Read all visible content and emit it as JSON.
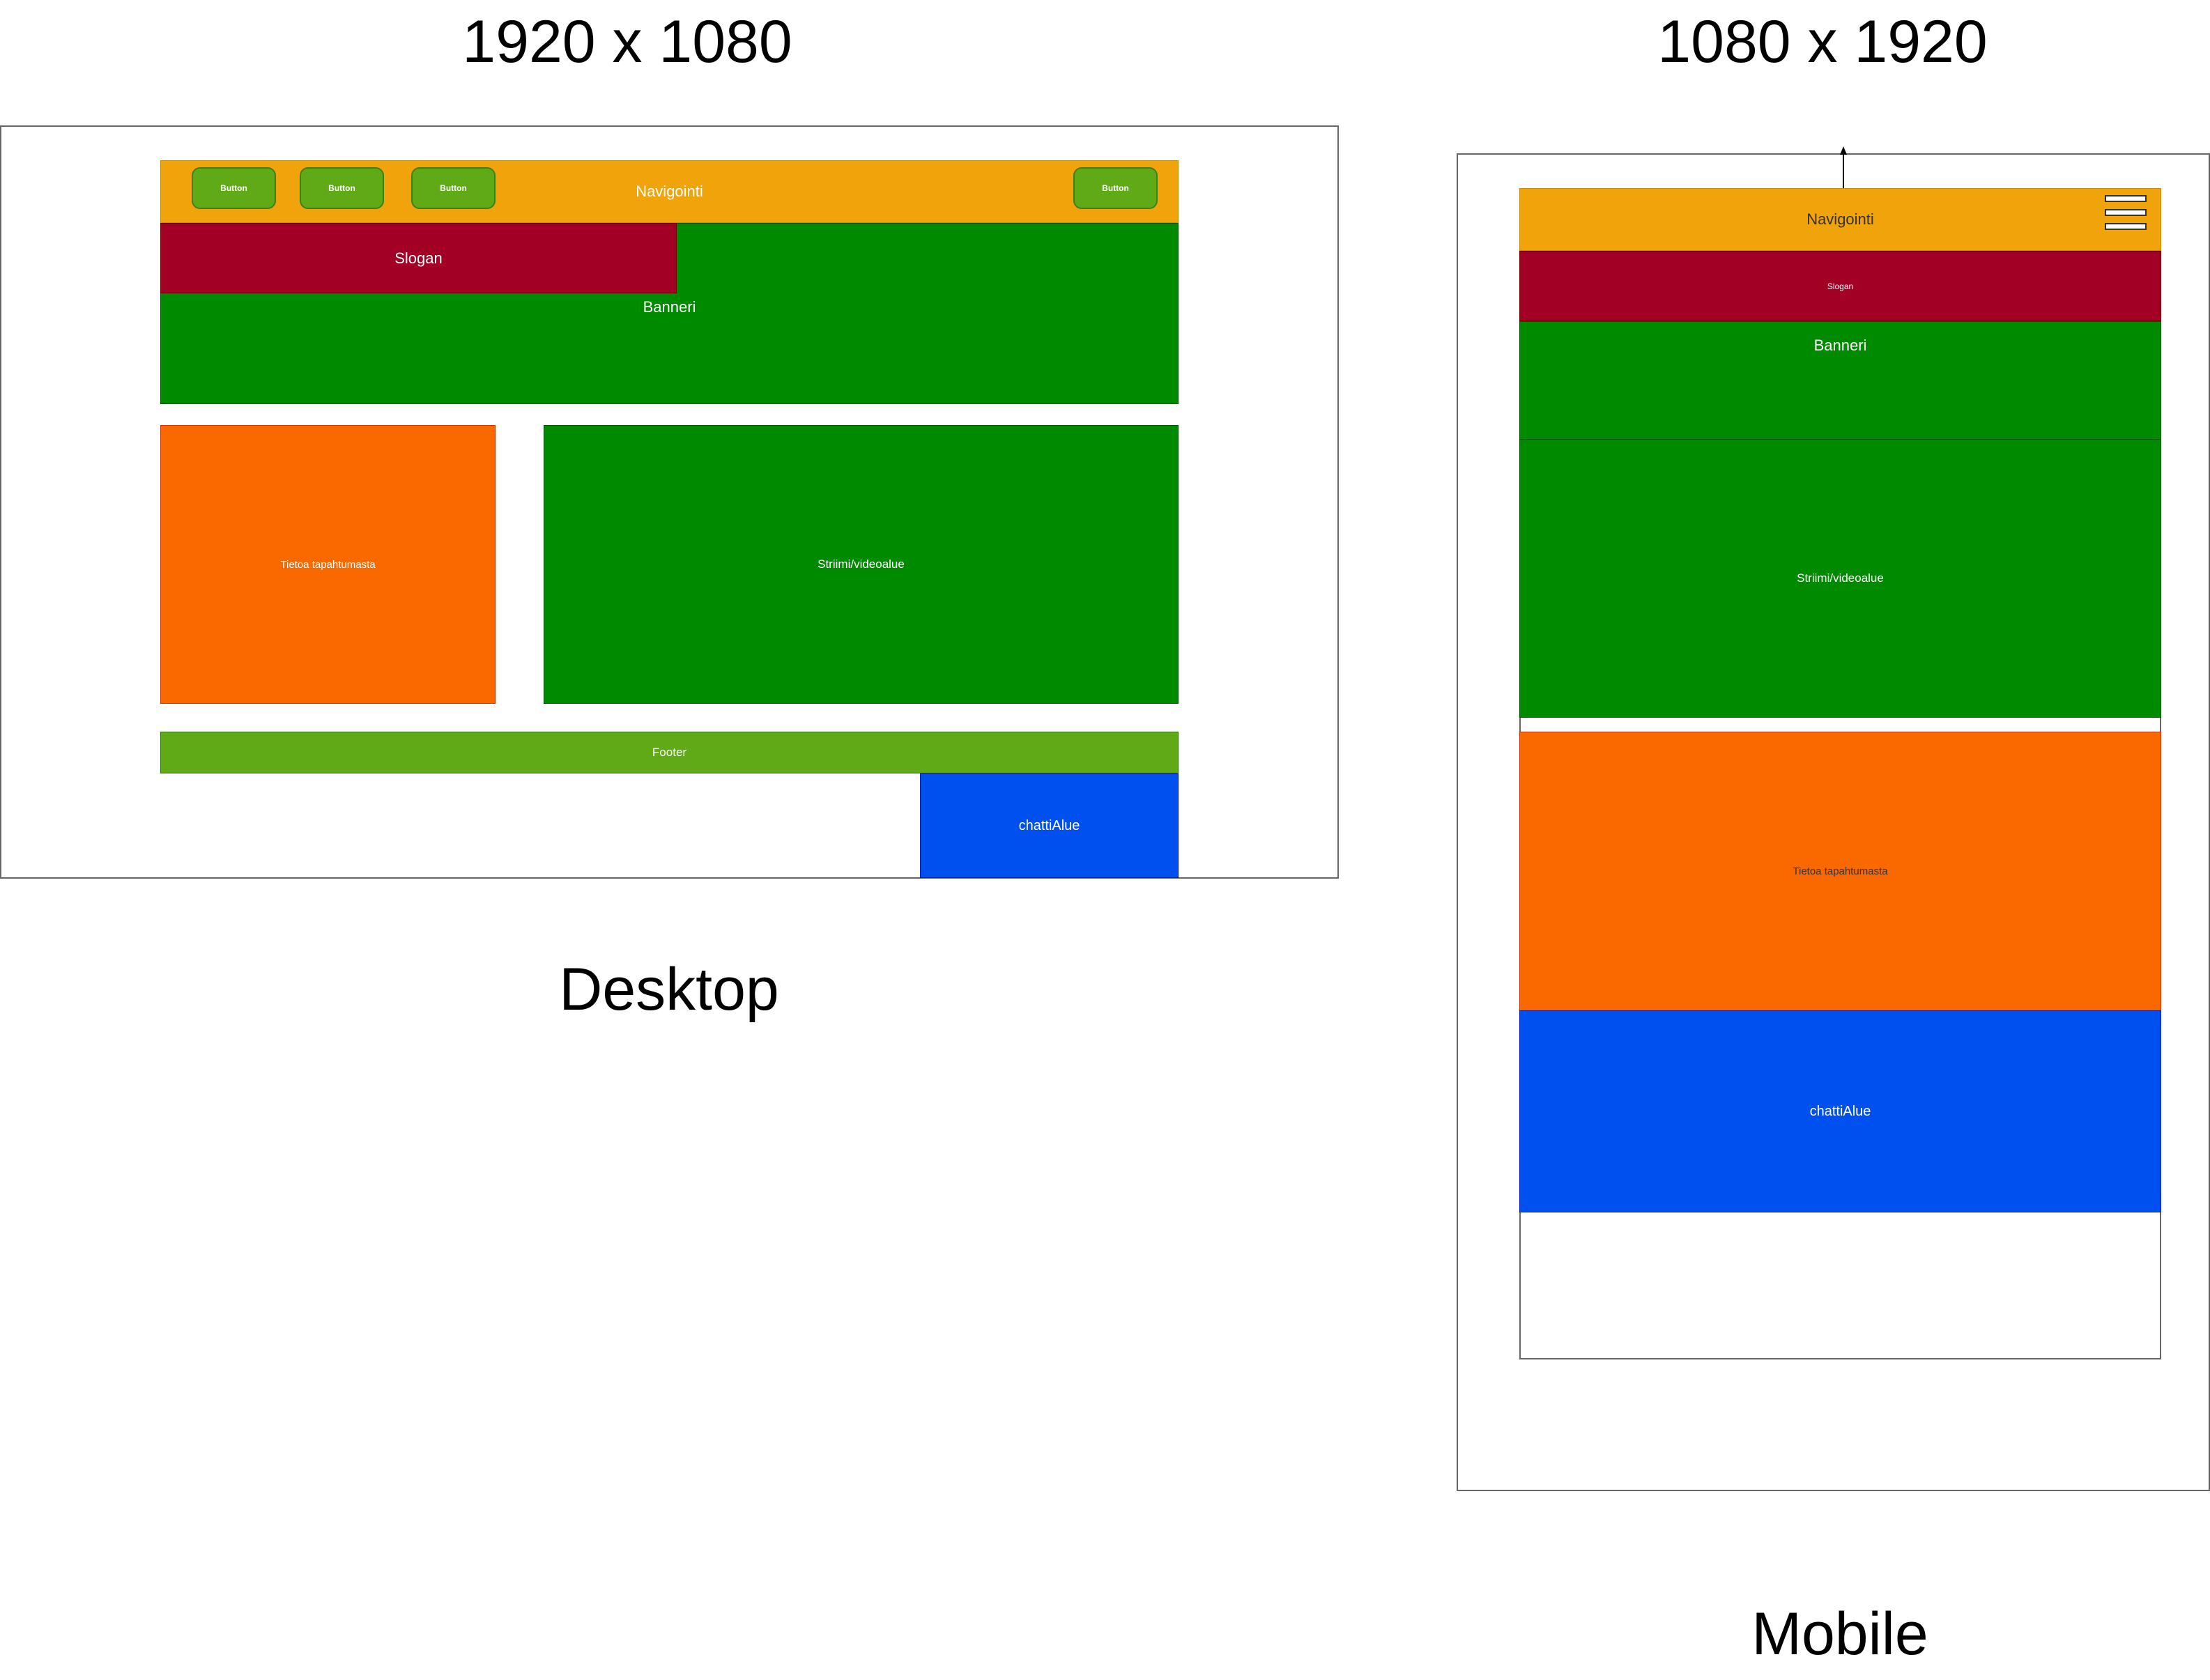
{
  "colors": {
    "nav": "#f0a30a",
    "slogan": "#a20025",
    "banner": "#008a00",
    "info": "#fa6800",
    "stream": "#008a00",
    "footer": "#60a917",
    "chat": "#0050ef",
    "button": "#60a917"
  },
  "desktop": {
    "resolution": "1920 x 1080",
    "caption": "Desktop",
    "nav_label": "Navigointi",
    "buttons": [
      "Button",
      "Button",
      "Button",
      "Button"
    ],
    "slogan": "Slogan",
    "banner": "Banneri",
    "info": "Tietoa tapahtumasta",
    "stream": "Striimi/videoalue",
    "footer": "Footer",
    "chat": "chattiAlue"
  },
  "mobile": {
    "resolution": "1080 x 1920",
    "caption": "Mobile",
    "nav_label": "Navigointi",
    "menu_icon": "hamburger-icon",
    "slogan": "Slogan",
    "banner": "Banneri",
    "stream": "Striimi/videoalue",
    "info": "Tietoa tapahtumasta",
    "chat": "chattiAlue"
  }
}
